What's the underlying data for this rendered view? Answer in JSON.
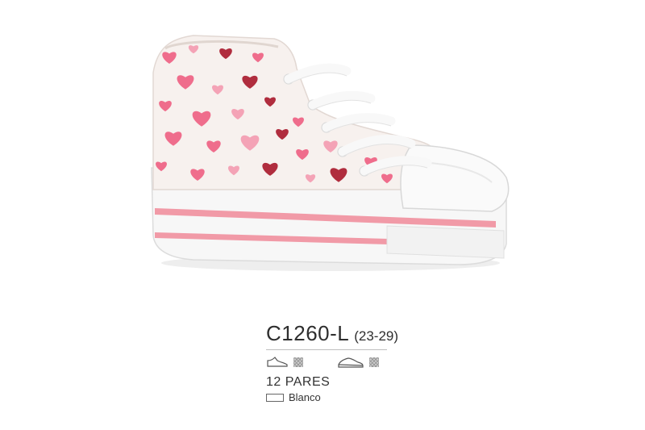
{
  "product": {
    "model_code": "C1260-L",
    "size_range": "(23-29)",
    "pairs": "12 PARES",
    "color_name": "Blanco",
    "upper_material_icon": "shoe-upper-icon",
    "sole_material_icon": "shoe-sole-icon",
    "colors": {
      "upper": "#f7f1ee",
      "heart_pink": "#ef6d8c",
      "heart_light": "#f4a3b6",
      "heart_dark": "#b02d3e",
      "stripe": "#f19aa7",
      "sole": "#f7f7f7"
    }
  }
}
